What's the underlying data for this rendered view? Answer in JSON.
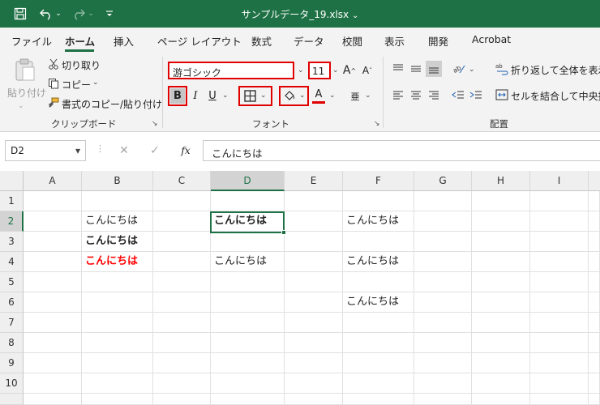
{
  "window": {
    "title": "サンプルデータ_19.xlsx",
    "title_chevron": "⌄"
  },
  "ribbon_tabs": [
    "ファイル",
    "ホーム",
    "挿入",
    "ページ レイアウト",
    "数式",
    "データ",
    "校閲",
    "表示",
    "開発",
    "Acrobat"
  ],
  "clipboard": {
    "paste_label": "貼り付け",
    "cut_label": "切り取り",
    "copy_label": "コピー",
    "format_painter_label": "書式のコピー/貼り付け",
    "group_label": "クリップボード"
  },
  "font": {
    "font_name": "游ゴシック",
    "font_size": "11",
    "bold_label": "B",
    "italic_label": "I",
    "underline_label": "U",
    "font_color_label": "A",
    "phonetic_label": "亜",
    "group_label": "フォント"
  },
  "alignment": {
    "wrap_text_label": "折り返して全体を表示す",
    "merge_center_label": "セルを結合して中央揃え",
    "group_label": "配置"
  },
  "formula_bar": {
    "name_box": "D2",
    "formula": "こんにちは",
    "fx_label": "fx"
  },
  "sheet": {
    "columns": [
      "A",
      "B",
      "C",
      "D",
      "E",
      "F",
      "G",
      "H",
      "I"
    ],
    "selected_column": "D",
    "rows": [
      "1",
      "2",
      "3",
      "4",
      "5",
      "6",
      "7",
      "8",
      "9",
      "10"
    ],
    "selected_row": "2",
    "cells": {
      "B2": "こんにちは",
      "D2": "こんにちは",
      "F2": "こんにちは",
      "B3": "こんにちは",
      "B4": "こんにちは",
      "D4": "こんにちは",
      "F4": "こんにちは",
      "F6": "こんにちは"
    }
  },
  "colors": {
    "accent": "#1e7145",
    "highlight_border": "#e00000",
    "red_text": "#ff0000"
  }
}
